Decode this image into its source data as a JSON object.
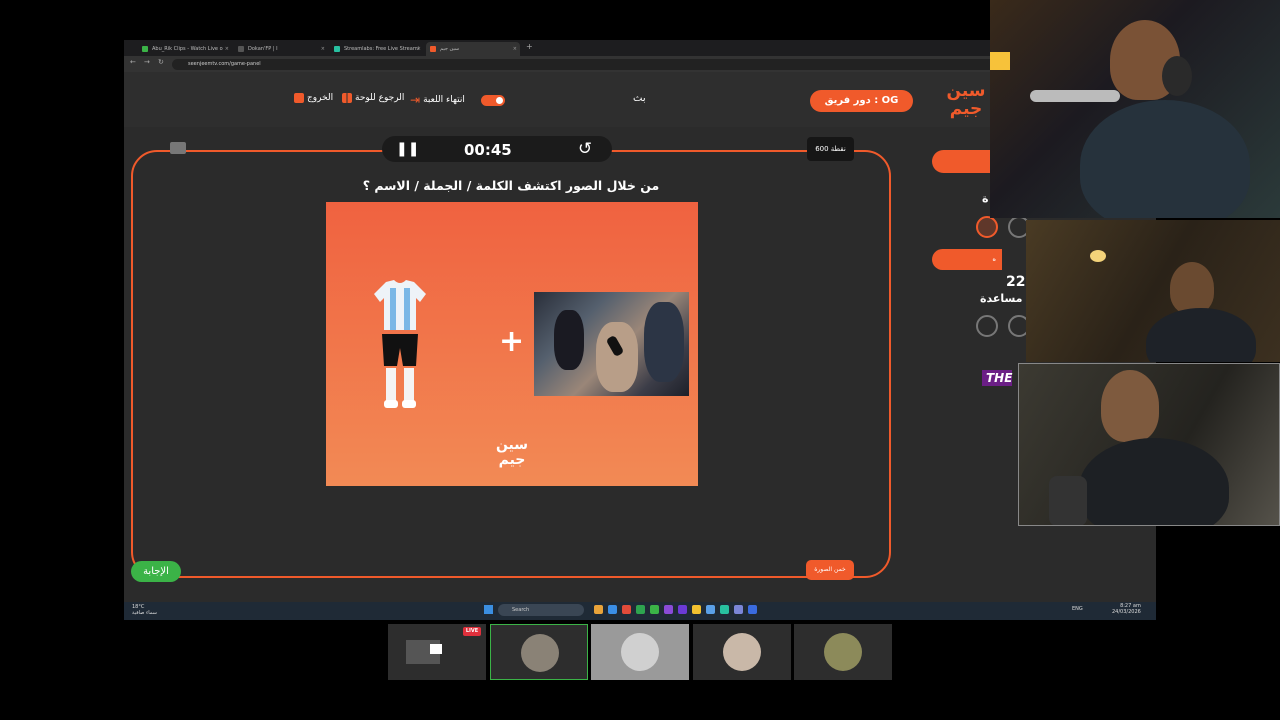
{
  "browser": {
    "tabs": [
      {
        "label": "Abu_Rik Clips - Watch Live o",
        "color": "#3bb347"
      },
      {
        "label": "Dokan'FP | I",
        "color": "#555"
      },
      {
        "label": "Streamlabs: Free Live Streami",
        "color": "#28c0a0"
      },
      {
        "label": "سين جيم",
        "color": "#f05a2b"
      }
    ],
    "url": "seenjeemtv.com/game-panel"
  },
  "header": {
    "exit_label": "الخروج",
    "back_label": "الرجوع للوحة",
    "end_game_label": "انتهاء اللعبة",
    "center_text": "بث",
    "team_turn_label": "دور فريق : OG",
    "logo_text": "سين جيم"
  },
  "game": {
    "timer": "00:45",
    "points": "600 نقطة",
    "question": "من خلال الصور اكتشف الكلمة / الجملة / الاسم ؟",
    "card_logo": "سين جيم",
    "answer_label": "الإجابة",
    "hint_label": "خمن الصورة"
  },
  "sidebar": {
    "letter": "ة",
    "score": "22",
    "help_label": "مساعدة",
    "banner": "THE",
    "pill2_text": "ه"
  },
  "taskbar": {
    "weather_temp": "18°C",
    "weather_desc": "سماء صافية",
    "search_placeholder": "Search",
    "time": "8:27 am",
    "date": "24/03/2026",
    "lang": "ENG"
  },
  "participants": {
    "live_label": "LIVE"
  },
  "colors": {
    "accent": "#f05a2b",
    "answer_green": "#3bb347"
  }
}
